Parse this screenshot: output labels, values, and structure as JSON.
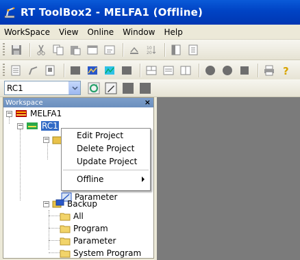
{
  "window": {
    "title": "RT ToolBox2 - MELFA1  (Offline)",
    "icon": "robot-arm-app-icon"
  },
  "menubar": {
    "items": [
      "WorkSpace",
      "View",
      "Online",
      "Window",
      "Help"
    ]
  },
  "toolbar1": {
    "buttons": [
      "save-icon",
      "cut-icon",
      "copy-icon",
      "paste-icon",
      "window-icon",
      "save-all-icon",
      "print-icon",
      "sort-icon",
      "page-icon",
      "page-alt-icon"
    ]
  },
  "toolbar2": {
    "buttons": [
      "ladder-icon",
      "robot-icon",
      "monitor-icon",
      "grid-icon",
      "chart-icon",
      "chart-blue-icon",
      "stop-icon",
      "tile-icon",
      "list-icon",
      "panel-icon",
      "circle-icon",
      "circle-alt-icon",
      "window-alt-icon",
      "print-alt-icon",
      "help-icon"
    ]
  },
  "robot_selector": {
    "value": "RC1"
  },
  "workspace": {
    "title": "Workspace",
    "close": "×",
    "tree": {
      "root": "MELFA1",
      "rc": "RC1",
      "parameter": "Parameter",
      "backup": "Backup",
      "backup_items": [
        "All",
        "Program",
        "Parameter",
        "System Program"
      ]
    }
  },
  "context_menu": {
    "items": [
      "Edit Project",
      "Delete Project",
      "Update Project"
    ],
    "submenu_item": "Offline"
  },
  "colors": {
    "titlebar": "#0043c4",
    "workspace_header": "#6b8fbe",
    "workarea": "#7b7b7b"
  }
}
